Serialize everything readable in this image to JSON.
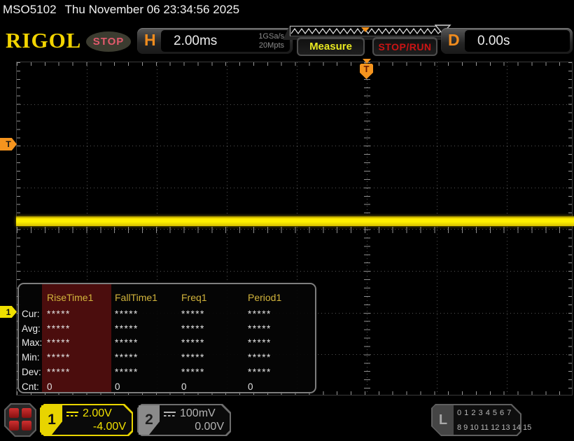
{
  "titlebar": {
    "model": "MSO5102",
    "datetime": "Thu November 06 23:34:56 2025"
  },
  "header": {
    "logo": "RIGOL",
    "run_state": "STOP",
    "horizontal": {
      "label": "H",
      "timebase": "2.00ms",
      "sample_rate": "1GSa/s",
      "mem_depth": "20Mpts"
    },
    "measure_label": "Measure",
    "stoprun_label": "STOP/RUN",
    "delay": {
      "label": "D",
      "value": "0.00s"
    }
  },
  "markers": {
    "trigger_level_label": "T",
    "trigger_position_label": "T",
    "ch1_label": "1"
  },
  "measure_table": {
    "selected_column": "RiseTime1",
    "columns": [
      "RiseTime1",
      "FallTime1",
      "Freq1",
      "Period1"
    ],
    "rows": [
      {
        "label": "Cur:",
        "v": [
          "*****",
          "*****",
          "*****",
          "*****"
        ]
      },
      {
        "label": "Avg:",
        "v": [
          "*****",
          "*****",
          "*****",
          "*****"
        ]
      },
      {
        "label": "Max:",
        "v": [
          "*****",
          "*****",
          "*****",
          "*****"
        ]
      },
      {
        "label": "Min:",
        "v": [
          "*****",
          "*****",
          "*****",
          "*****"
        ]
      },
      {
        "label": "Dev:",
        "v": [
          "*****",
          "*****",
          "*****",
          "*****"
        ]
      },
      {
        "label": "Cnt:",
        "v": [
          "0",
          "0",
          "0",
          "0"
        ]
      }
    ]
  },
  "bottom": {
    "ch1": {
      "number": "1",
      "scale": "2.00V",
      "offset": "-4.00V",
      "coupling": "dc-coupling-icon"
    },
    "ch2": {
      "number": "2",
      "scale": "100mV",
      "offset": "0.00V",
      "coupling": "dc-coupling-icon"
    },
    "la": {
      "label": "L",
      "row1": "0 1 2 3  4 5 6 7",
      "row2": "8 9 10 11 12 13 14 15"
    }
  },
  "colors": {
    "ch1_yellow": "#f0e000",
    "ch2_gray": "#b4b4b4",
    "accent_orange": "#f5941e",
    "logo_yellow": "#f2d400",
    "stop_badge_red": "#e25a6c",
    "stoprun_red": "#cc1414",
    "measure_yellow": "#e8e820",
    "table_header_gold": "#d2b43c",
    "table_selected_bg": "#4b0d0d",
    "trace_yellow": "#ffec00"
  }
}
